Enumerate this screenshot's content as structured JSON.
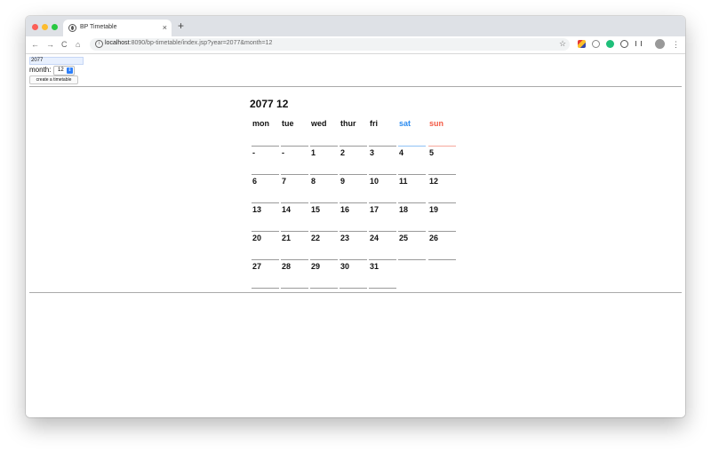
{
  "browser": {
    "tab_title": "BP Timetable",
    "new_tab_label": "+",
    "close_tab_label": "×",
    "url_host": "localhost",
    "url_rest": ":8090/bp-timetable/index.jsp?year=2077&month=12",
    "back": "←",
    "forward": "→",
    "reload": "C",
    "home": "⌂",
    "star": "☆",
    "menu": "⋮"
  },
  "form": {
    "year_value": "2077",
    "month_label": "month:",
    "month_value": "12",
    "create_label": "create a timetable"
  },
  "calendar": {
    "title": "2077 12",
    "days": [
      "mon",
      "tue",
      "wed",
      "thur",
      "fri",
      "sat",
      "sun"
    ],
    "weeks": [
      [
        "-",
        "-",
        "1",
        "2",
        "3",
        "4",
        "5"
      ],
      [
        "6",
        "7",
        "8",
        "9",
        "10",
        "11",
        "12"
      ],
      [
        "13",
        "14",
        "15",
        "16",
        "17",
        "18",
        "19"
      ],
      [
        "20",
        "21",
        "22",
        "23",
        "24",
        "25",
        "26"
      ],
      [
        "27",
        "28",
        "29",
        "30",
        "31",
        "",
        ""
      ]
    ]
  },
  "colors": {
    "sat": "#2d8cf0",
    "sun": "#f35a45"
  }
}
